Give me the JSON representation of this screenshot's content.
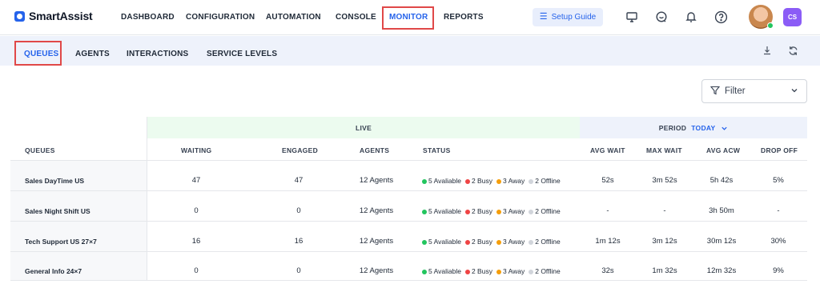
{
  "app": {
    "name": "SmartAssist",
    "brand_color": "#2563eb",
    "highlight_color": "#e04848"
  },
  "topnav": {
    "items": [
      {
        "label": "DASHBOARD",
        "active": false
      },
      {
        "label": "CONFIGURATION",
        "active": false
      },
      {
        "label": "AUTOMATION",
        "active": false
      },
      {
        "label": "CONSOLE",
        "active": false
      },
      {
        "label": "MONITOR",
        "active": true
      },
      {
        "label": "REPORTS",
        "active": false
      }
    ],
    "setup_guide_label": "Setup Guide",
    "icons": [
      "monitor-icon",
      "chat-bubble-icon",
      "bell-icon",
      "help-icon"
    ],
    "user_initials": "CS"
  },
  "subnav": {
    "tabs": [
      {
        "label": "QUEUES",
        "active": true
      },
      {
        "label": "AGENTS",
        "active": false
      },
      {
        "label": "INTERACTIONS",
        "active": false
      },
      {
        "label": "SERVICE LEVELS",
        "active": false
      }
    ],
    "icons": [
      "download-icon",
      "refresh-icon"
    ]
  },
  "filter": {
    "label": "Filter"
  },
  "table": {
    "live_label": "LIVE",
    "period_label": "PERIOD",
    "period_value": "TODAY",
    "headers": {
      "queues": "QUEUES",
      "waiting": "WAITING",
      "engaged": "ENGAGED",
      "agents": "AGENTS",
      "status": "STATUS",
      "avg_wait": "AVG WAIT",
      "max_wait": "MAX WAIT",
      "avg_acw": "AVG ACW",
      "drop_off": "DROP OFF"
    },
    "status_colors": {
      "available": "#22c55e",
      "busy": "#ef4444",
      "away": "#f59e0b",
      "offline": "#d1d5db"
    },
    "rows": [
      {
        "name": "Sales DayTime US",
        "waiting": "47",
        "engaged": "47",
        "agents": "12 Agents",
        "available": "5 Avaliable",
        "busy": "2 Busy",
        "away": "3 Away",
        "offline": "2 Offline",
        "avg_wait": "52s",
        "max_wait": "3m 52s",
        "avg_acw": "5h 42s",
        "drop_off": "5%"
      },
      {
        "name": "Sales Night Shift US",
        "waiting": "0",
        "engaged": "0",
        "agents": "12 Agents",
        "available": "5 Avaliable",
        "busy": "2 Busy",
        "away": "3 Away",
        "offline": "2 Offline",
        "avg_wait": "-",
        "max_wait": "-",
        "avg_acw": "3h 50m",
        "drop_off": "-"
      },
      {
        "name": "Tech Support US 27×7",
        "waiting": "16",
        "engaged": "16",
        "agents": "12 Agents",
        "available": "5 Avaliable",
        "busy": "2 Busy",
        "away": "3 Away",
        "offline": "2 Offline",
        "avg_wait": "1m 12s",
        "max_wait": "3m 12s",
        "avg_acw": "30m 12s",
        "drop_off": "30%"
      },
      {
        "name": "General Info 24×7",
        "waiting": "0",
        "engaged": "0",
        "agents": "12 Agents",
        "available": "5 Avaliable",
        "busy": "2 Busy",
        "away": "3 Away",
        "offline": "2 Offline",
        "avg_wait": "32s",
        "max_wait": "1m 32s",
        "avg_acw": "12m 32s",
        "drop_off": "9%"
      }
    ]
  }
}
